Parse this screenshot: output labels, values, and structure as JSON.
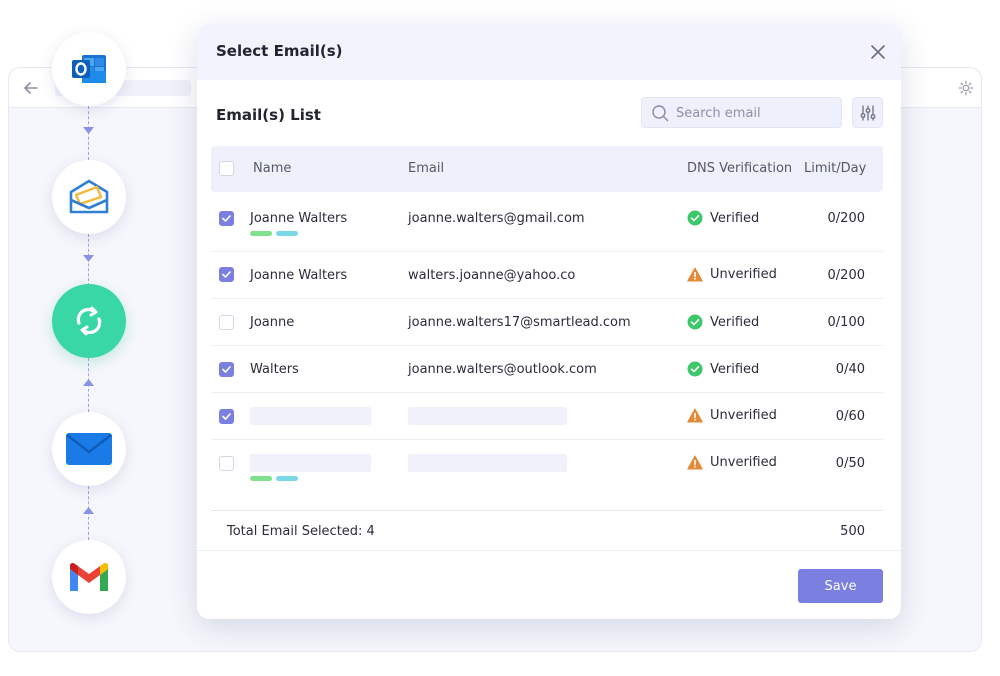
{
  "modal": {
    "title": "Select Email(s)",
    "list_title": "Email(s) List",
    "search_placeholder": "Search email"
  },
  "table": {
    "headers": {
      "name": "Name",
      "email": "Email",
      "dns": "DNS Verification",
      "limit": "Limit/Day"
    },
    "rows": [
      {
        "checked": true,
        "name": "Joanne Walters",
        "email": "joanne.walters@gmail.com",
        "status": "Verified",
        "limit": "0/200",
        "tags": true
      },
      {
        "checked": true,
        "name": "Joanne Walters",
        "email": "walters.joanne@yahoo.co",
        "status": "Unverified",
        "limit": "0/200",
        "tags": false
      },
      {
        "checked": false,
        "name": "Joanne",
        "email": "joanne.walters17@smartlead.com",
        "status": "Verified",
        "limit": "0/100",
        "tags": false
      },
      {
        "checked": true,
        "name": "Walters",
        "email": "joanne.walters@outlook.com",
        "status": "Verified",
        "limit": "0/40",
        "tags": false
      },
      {
        "checked": true,
        "name": "",
        "email": "",
        "status": "Unverified",
        "limit": "0/60",
        "tags": false
      },
      {
        "checked": false,
        "name": "",
        "email": "",
        "status": "Unverified",
        "limit": "0/50",
        "tags": true
      }
    ]
  },
  "total": {
    "label": "Total Email Selected: 4",
    "value": "500"
  },
  "footer": {
    "save_label": "Save"
  },
  "colors": {
    "accent": "#7a7fe0",
    "verified": "#3ec76a",
    "unverified": "#e3893a",
    "tag_green": "#7fe08d",
    "tag_cyan": "#7ad8e6"
  },
  "icons": {
    "timeline": [
      "outlook-icon",
      "zoho-mail-icon",
      "sync-icon",
      "mail-icon",
      "gmail-icon"
    ]
  }
}
